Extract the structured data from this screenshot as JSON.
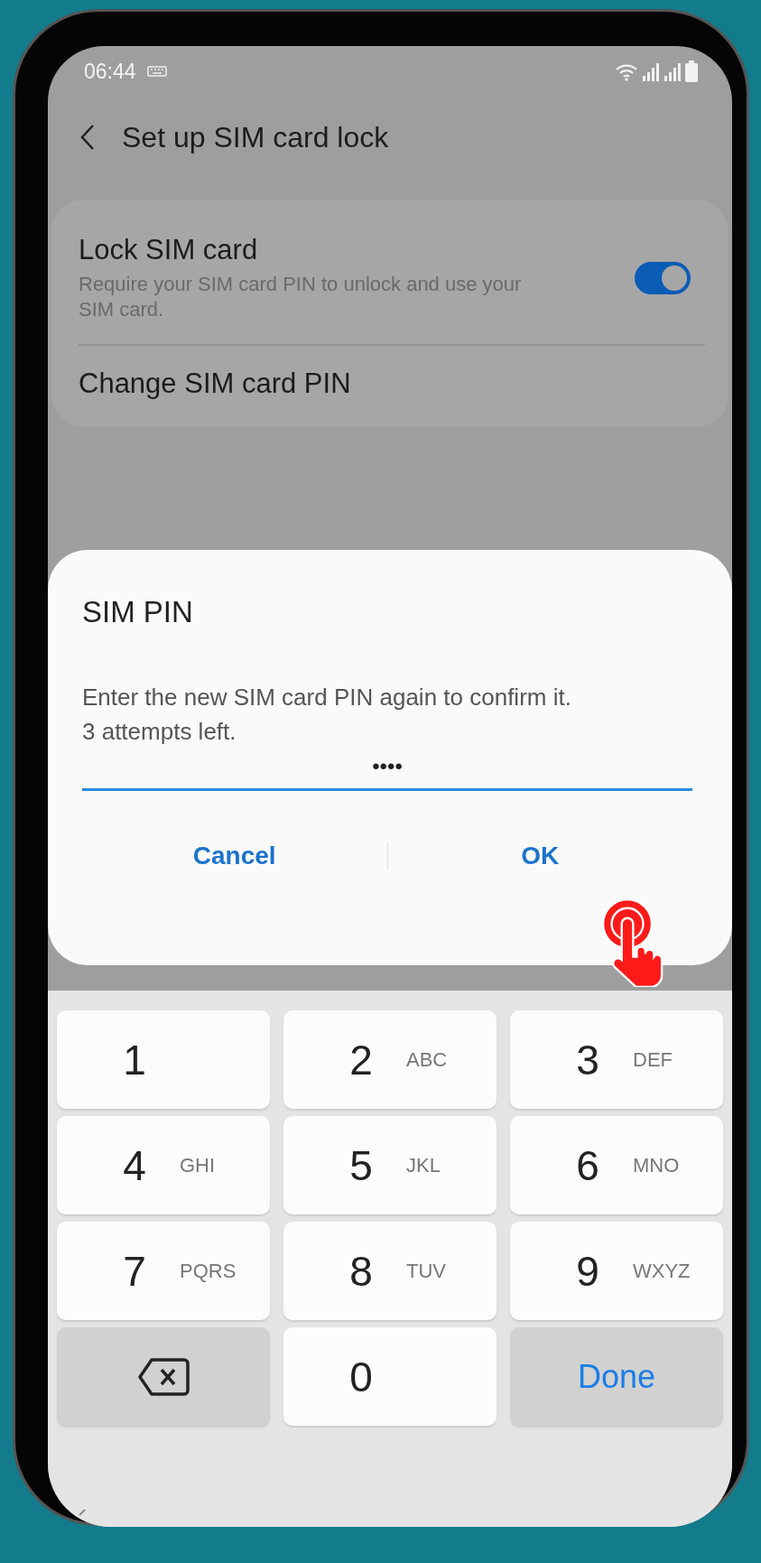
{
  "status_bar": {
    "time": "06:44"
  },
  "header": {
    "title": "Set up SIM card lock"
  },
  "settings": [
    {
      "kind": "toggle",
      "title": "Lock SIM card",
      "subtitle": "Require your SIM card PIN to unlock and use your SIM card.",
      "on": true
    },
    {
      "kind": "link",
      "title": "Change SIM card PIN"
    }
  ],
  "dialog": {
    "title": "SIM PIN",
    "message": "Enter the new SIM card PIN again to confirm it.\n3 attempts left.",
    "field": {
      "value": "••••"
    },
    "buttons": [
      {
        "label": "Cancel"
      },
      {
        "label": "OK"
      }
    ]
  },
  "keypad": {
    "keys": [
      {
        "kind": "digit",
        "digit": "1"
      },
      {
        "kind": "digit",
        "digit": "2",
        "letters": "ABC"
      },
      {
        "kind": "digit",
        "digit": "3",
        "letters": "DEF"
      },
      {
        "kind": "digit",
        "digit": "4",
        "letters": "GHI"
      },
      {
        "kind": "digit",
        "digit": "5",
        "letters": "JKL"
      },
      {
        "kind": "digit",
        "digit": "6",
        "letters": "MNO"
      },
      {
        "kind": "digit",
        "digit": "7",
        "letters": "PQRS"
      },
      {
        "kind": "digit",
        "digit": "8",
        "letters": "TUV"
      },
      {
        "kind": "digit",
        "digit": "9",
        "letters": "WXYZ"
      },
      {
        "kind": "backspace"
      },
      {
        "kind": "digit",
        "digit": "0"
      },
      {
        "kind": "done",
        "label": "Done"
      }
    ]
  }
}
